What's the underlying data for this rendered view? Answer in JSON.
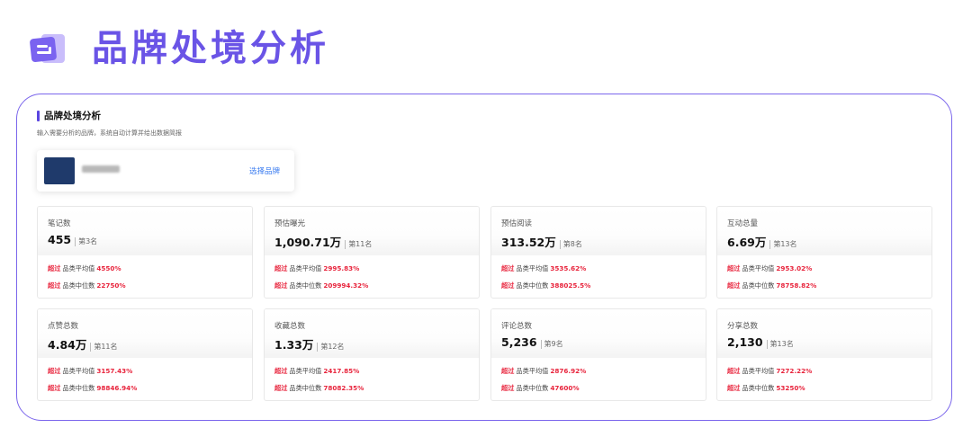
{
  "hero": {
    "title": "品牌处境分析"
  },
  "section": {
    "title": "品牌处境分析",
    "subtitle": "输入需要分析的品牌，系统自动计算并给出数据简报"
  },
  "brand": {
    "select_label": "选择品牌"
  },
  "compare": {
    "over": "超过",
    "avg_label": "品类平均值",
    "median_label": "品类中位数"
  },
  "metrics": [
    {
      "label": "笔记数",
      "value": "455",
      "rank": "第3名",
      "avg_pct": "4550%",
      "median_pct": "22750%"
    },
    {
      "label": "预估曝光",
      "value": "1,090.71万",
      "rank": "第11名",
      "avg_pct": "2995.83%",
      "median_pct": "209994.32%"
    },
    {
      "label": "预估阅读",
      "value": "313.52万",
      "rank": "第8名",
      "avg_pct": "3535.62%",
      "median_pct": "388025.5%"
    },
    {
      "label": "互动总量",
      "value": "6.69万",
      "rank": "第13名",
      "avg_pct": "2953.02%",
      "median_pct": "78758.82%"
    },
    {
      "label": "点赞总数",
      "value": "4.84万",
      "rank": "第11名",
      "avg_pct": "3157.43%",
      "median_pct": "98846.94%"
    },
    {
      "label": "收藏总数",
      "value": "1.33万",
      "rank": "第12名",
      "avg_pct": "2417.85%",
      "median_pct": "78082.35%"
    },
    {
      "label": "评论总数",
      "value": "5,236",
      "rank": "第9名",
      "avg_pct": "2876.92%",
      "median_pct": "47600%"
    },
    {
      "label": "分享总数",
      "value": "2,130",
      "rank": "第13名",
      "avg_pct": "7272.22%",
      "median_pct": "53250%"
    }
  ],
  "colors": {
    "accent": "#6a54e6",
    "border": "#7b66ec",
    "highlight": "#e8253d",
    "link": "#3b7cf0"
  },
  "icons": {
    "hero": "card-stack-icon"
  }
}
